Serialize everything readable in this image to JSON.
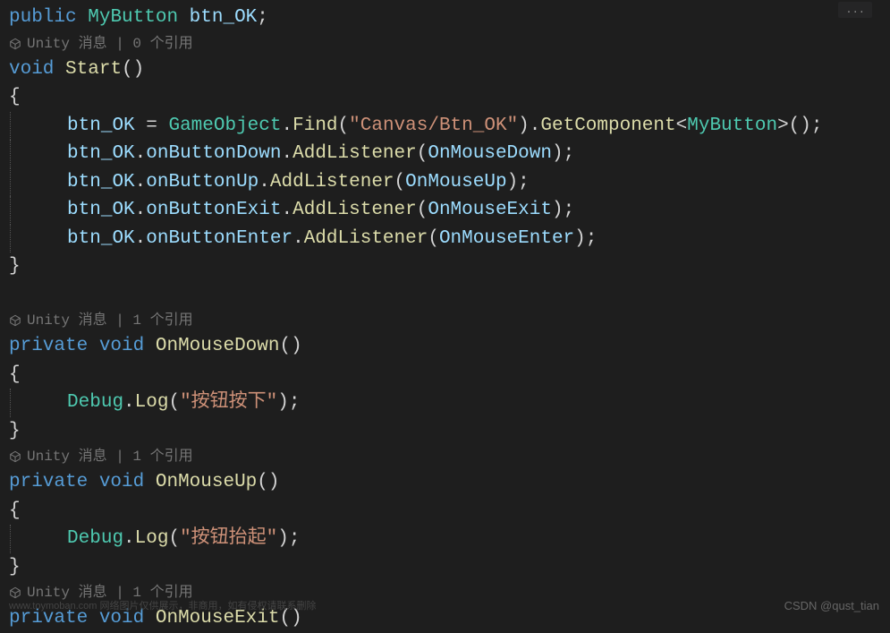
{
  "topDots": "...",
  "codelens": {
    "ref0": "Unity 消息 | 0 个引用",
    "ref1a": "Unity 消息 | 1 个引用",
    "ref1b": "Unity 消息 | 1 个引用",
    "ref1c": "Unity 消息 | 1 个引用"
  },
  "tokens": {
    "public": "public",
    "private": "private",
    "void": "void",
    "MyButton": "MyButton",
    "btn_OK": "btn_OK",
    "Start": "Start",
    "GameObject": "GameObject",
    "Find": "Find",
    "canvasPath": "\"Canvas/Btn_OK\"",
    "GetComponent": "GetComponent",
    "onButtonDown": "onButtonDown",
    "onButtonUp": "onButtonUp",
    "onButtonExit": "onButtonExit",
    "onButtonEnter": "onButtonEnter",
    "AddListener": "AddListener",
    "OnMouseDown": "OnMouseDown",
    "OnMouseUp": "OnMouseUp",
    "OnMouseExit": "OnMouseExit",
    "OnMouseEnter": "OnMouseEnter",
    "Debug": "Debug",
    "Log": "Log",
    "strDown": "\"按钮按下\"",
    "strUp": "\"按钮抬起\""
  },
  "watermark": "CSDN @qust_tian",
  "watermarkFaint": "www.toymoban.com 网络图片仅供展示，非商用，如有侵权请联系删除"
}
